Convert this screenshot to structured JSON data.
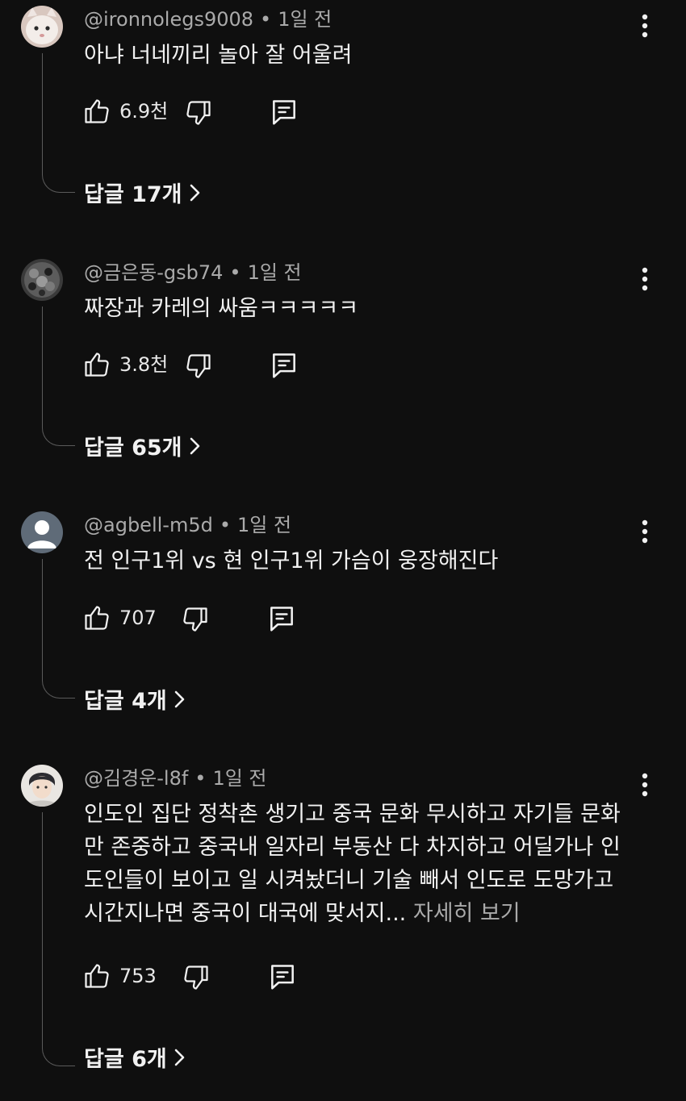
{
  "comments": [
    {
      "handle": "@ironnolegs9008",
      "sep": "•",
      "age": "1일 전",
      "text": "아냐 너네끼리 놀아 잘 어울려",
      "likes": "6.9천",
      "replies": "답글 17개",
      "avatar": "cat-avatar"
    },
    {
      "handle": "@금은동-gsb74",
      "sep": "•",
      "age": "1일 전",
      "text": "짜장과 카레의 싸움ㅋㅋㅋㅋㅋ",
      "likes": "3.8천",
      "replies": "답글 65개",
      "avatar": "pattern-avatar"
    },
    {
      "handle": "@agbell-m5d",
      "sep": "•",
      "age": "1일 전",
      "text": "전 인구1위 vs 현 인구1위 가슴이 웅장해진다",
      "likes": "707",
      "replies": "답글 4개",
      "avatar": "default-avatar"
    },
    {
      "handle": "@김경운-l8f",
      "sep": "•",
      "age": "1일 전",
      "text": "인도인 집단 정착촌 생기고 중국 문화 무시하고 자기들 문화만 존중하고 중국내 일자리 부동산 다 차지하고 어딜가나 인도인들이 보이고 일 시켜놨더니 기술 빼서 인도로 도망가고 시간지나면 중국이 대국에 맞서지...",
      "more": " 자세히 보기",
      "likes": "753",
      "replies": "답글 6개",
      "avatar": "person-avatar"
    }
  ],
  "icons": {
    "like": "thumbs-up-icon",
    "dislike": "thumbs-down-icon",
    "reply": "comment-icon",
    "menu": "more-vert-icon",
    "chevron": "chevron-right-icon"
  },
  "colors": {
    "background": "#0f0f0f",
    "text": "#f1f1f1",
    "secondary": "#aaaaaa",
    "thread": "#5a5a5a"
  }
}
